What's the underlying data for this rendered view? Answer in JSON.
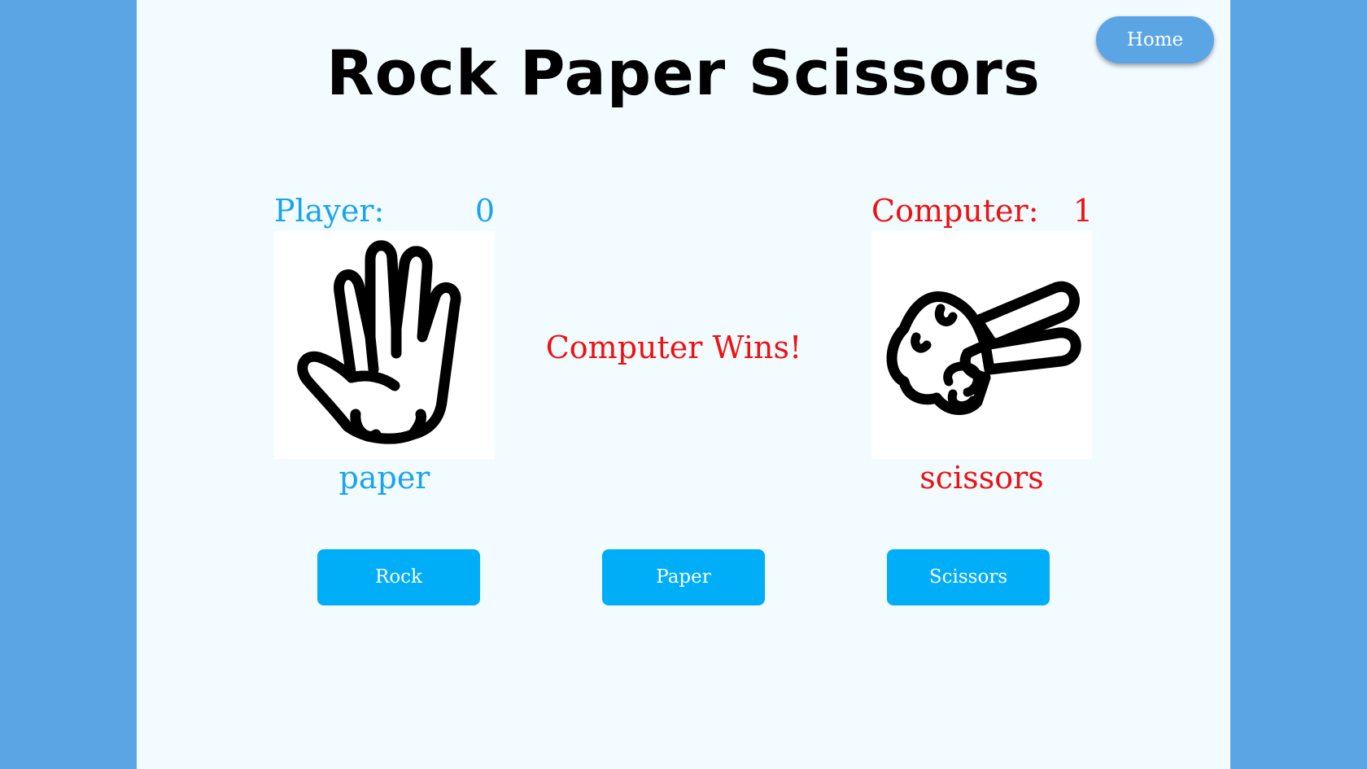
{
  "header": {
    "title": "Rock Paper Scissors",
    "home_label": "Home"
  },
  "player": {
    "label": "Player:",
    "score": "0",
    "choice": "paper",
    "choice_icon": "open-hand-icon"
  },
  "computer": {
    "label": "Computer:",
    "score": "1",
    "choice": "scissors",
    "choice_icon": "scissors-hand-icon"
  },
  "result": {
    "text": "Computer Wins!"
  },
  "controls": {
    "rock_label": "Rock",
    "paper_label": "Paper",
    "scissors_label": "Scissors"
  },
  "colors": {
    "background": "#5ba5e5",
    "panel": "#f2fbff",
    "player": "#1aa3ee",
    "computer": "#ee1111",
    "button": "#00aef8"
  }
}
